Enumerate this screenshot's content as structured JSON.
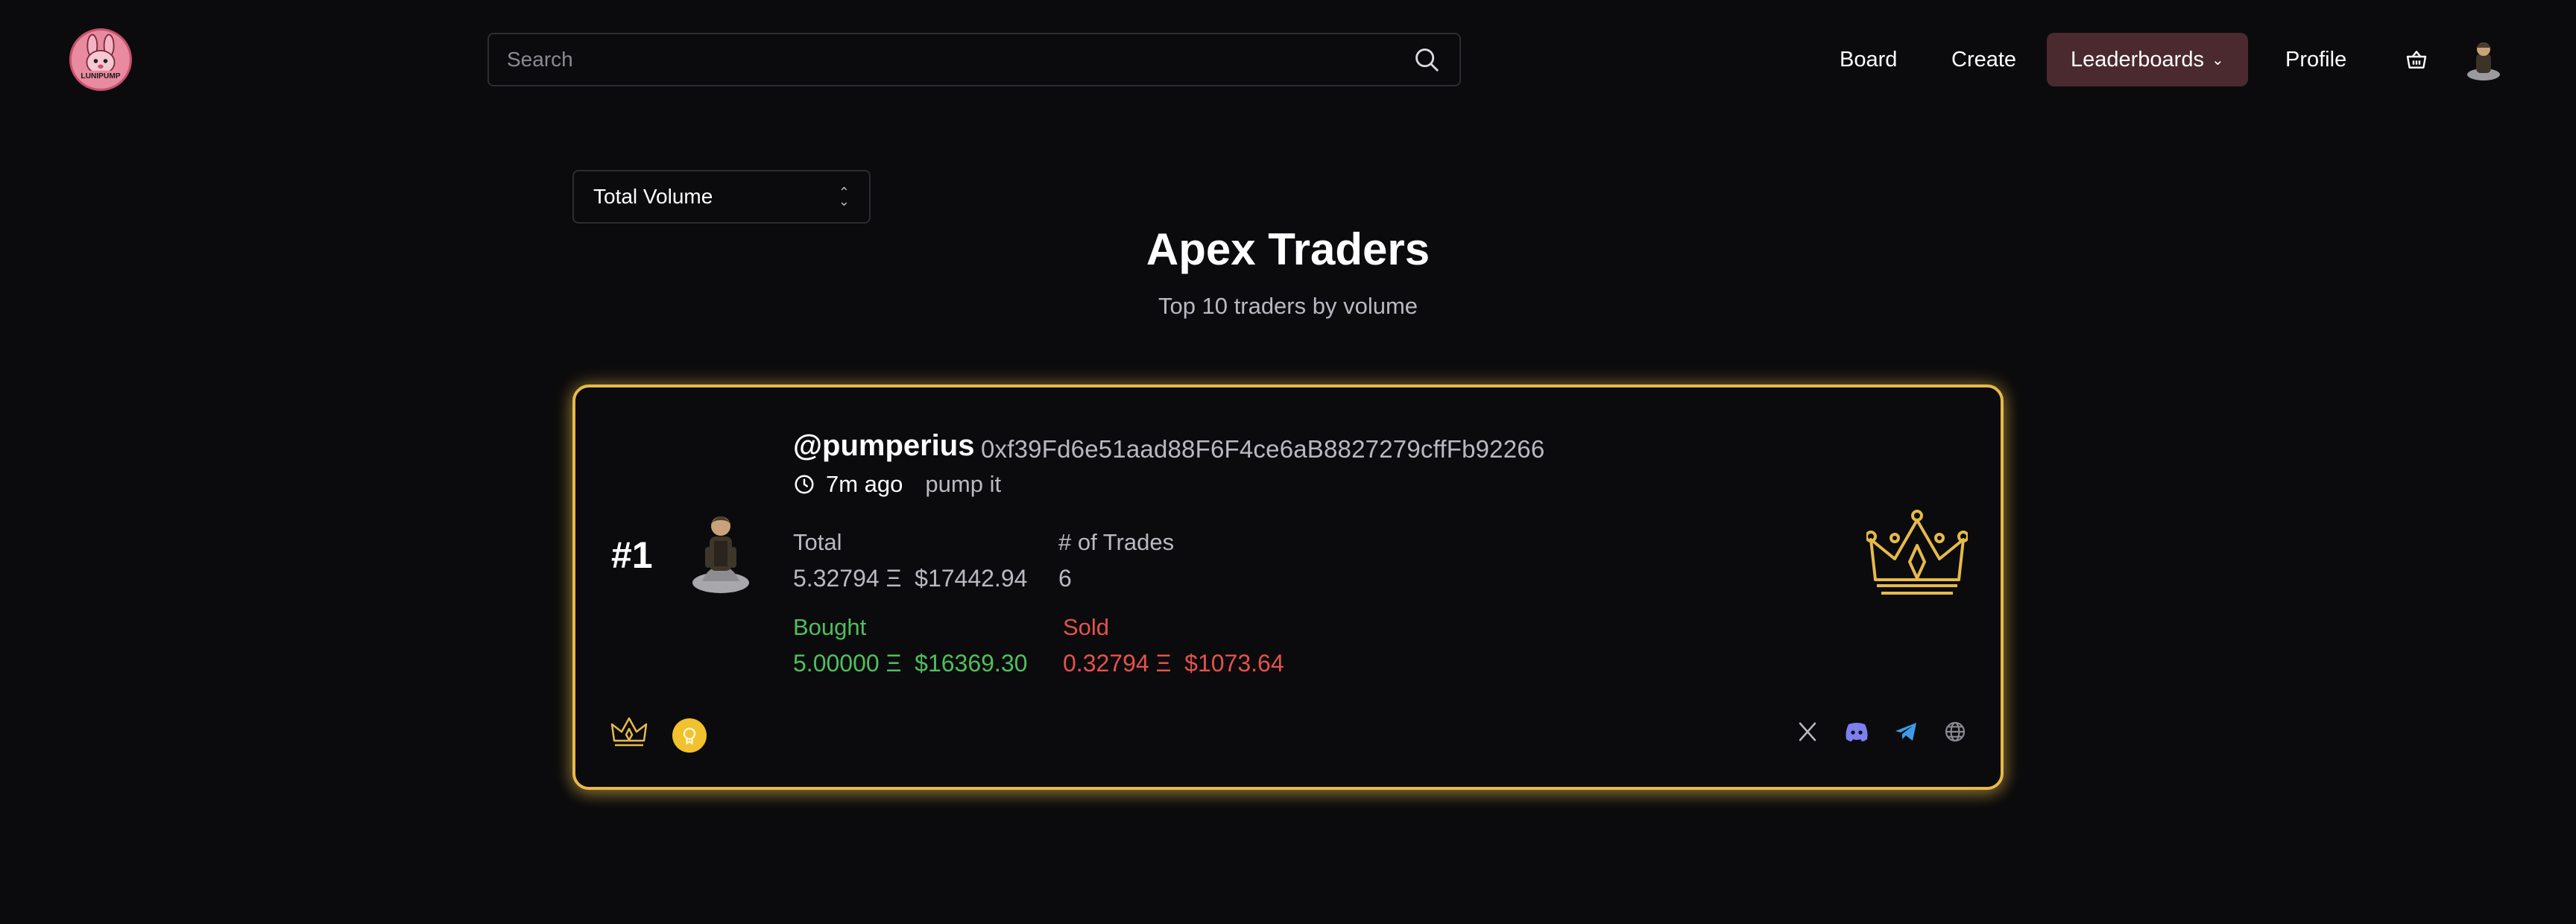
{
  "header": {
    "logo_text": "LUNIPUMP",
    "search": {
      "placeholder": "Search",
      "value": ""
    },
    "nav": {
      "board": "Board",
      "create": "Create",
      "leaderboards": "Leaderboards",
      "profile": "Profile"
    },
    "icons": [
      "search-icon",
      "chevron-down-icon",
      "basket-icon",
      "avatar"
    ]
  },
  "controls": {
    "sort_select": {
      "selected": "Total Volume"
    }
  },
  "page": {
    "title": "Apex Traders",
    "subtitle": "Top 10 traders by volume"
  },
  "leaderboard": [
    {
      "rank": "#1",
      "handle": "@pumperius",
      "address": "0xf39Fd6e51aad88F6F4ce6aB8827279cffFb92266",
      "time_ago": "7m ago",
      "bio": "pump it",
      "total_label": "Total",
      "total_value": "5.32794 Ξ  $17442.94",
      "trades_label": "# of Trades",
      "trades_value": "6",
      "bought_label": "Bought",
      "bought_value": "5.00000 Ξ  $16369.30",
      "sold_label": "Sold",
      "sold_value": "0.32794 Ξ  $1073.64",
      "badges": [
        "crown-badge-icon",
        "coin-badge-icon"
      ],
      "socials": [
        "x-icon",
        "discord-icon",
        "telegram-icon",
        "globe-icon"
      ]
    }
  ],
  "colors": {
    "background": "#0b0b0d",
    "accent_gold": "#e6b94a",
    "nav_active": "#4a2a2f",
    "positive": "#4fbf5e",
    "negative": "#e4524a",
    "muted_text": "#b9b9c1",
    "discord": "#7b7ff0",
    "telegram": "#3d9be9"
  }
}
